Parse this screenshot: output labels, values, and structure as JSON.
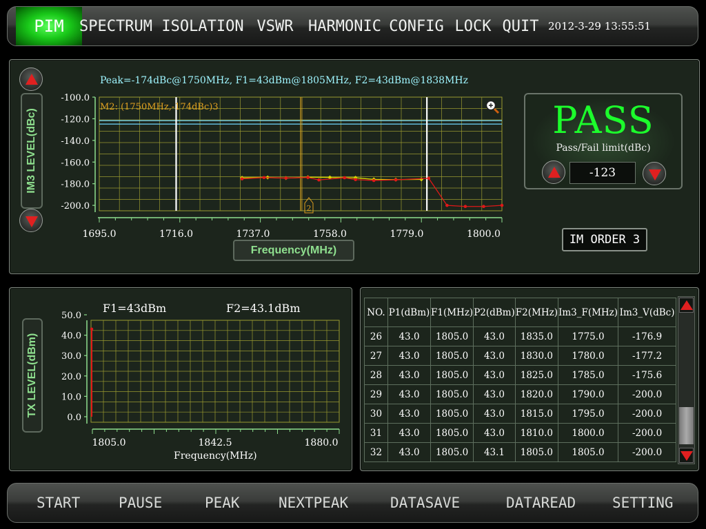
{
  "header": {
    "menu": [
      "PIM",
      "SPECTRUM",
      "ISOLATION",
      "VSWR",
      "HARMONIC",
      "CONFIG",
      "LOCK",
      "QUIT"
    ],
    "datetime": "2012-3-29 13:55:51"
  },
  "im3_panel": {
    "peak_info": "Peak=-174dBc@1750MHz, F1=43dBm@1805MHz, F2=43dBm@1838MHz",
    "y_axis_label": "IM3 LEVEL(dBc)",
    "x_axis_button": "Frequency(MHz)",
    "marker_label": "M2: (1750MHz,-174dBc)3",
    "marker_tag": "2",
    "zoom_icon": "magnifier-plus-icon"
  },
  "pass_panel": {
    "result": "PASS",
    "limit_label": "Pass/Fail limit(dBc)",
    "limit_value": "-123",
    "im_order": "IM ORDER 3"
  },
  "tx_panel": {
    "f1": "F1=43dBm",
    "f2": "F2=43.1dBm",
    "y_axis_label": "TX LEVEL(dBm)",
    "x_axis_label": "Frequency(MHz)"
  },
  "table": {
    "headers": [
      "NO.",
      "P1(dBm)",
      "F1(MHz)",
      "P2(dBm)",
      "F2(MHz)",
      "Im3_F(MHz)",
      "Im3_V(dBc)"
    ],
    "rows": [
      [
        "26",
        "43.0",
        "1805.0",
        "43.0",
        "1835.0",
        "1775.0",
        "-176.9"
      ],
      [
        "27",
        "43.0",
        "1805.0",
        "43.0",
        "1830.0",
        "1780.0",
        "-177.2"
      ],
      [
        "28",
        "43.0",
        "1805.0",
        "43.0",
        "1825.0",
        "1785.0",
        "-175.6"
      ],
      [
        "29",
        "43.0",
        "1805.0",
        "43.0",
        "1820.0",
        "1790.0",
        "-200.0"
      ],
      [
        "30",
        "43.0",
        "1805.0",
        "43.0",
        "1815.0",
        "1795.0",
        "-200.0"
      ],
      [
        "31",
        "43.0",
        "1805.0",
        "43.0",
        "1810.0",
        "1800.0",
        "-200.0"
      ],
      [
        "32",
        "43.0",
        "1805.0",
        "43.1",
        "1805.0",
        "1805.0",
        "-200.0"
      ]
    ]
  },
  "footer": {
    "buttons": [
      "START",
      "PAUSE",
      "PEAK",
      "NEXTPEAK",
      "DATASAVE",
      "DATAREAD",
      "SETTING"
    ]
  },
  "colors": {
    "pass": "#1cff2c",
    "limit_line": "#6fd6ff",
    "series_red": "#e01818",
    "series_yellow": "#d8d800",
    "grid": "#9a9a30"
  },
  "chart_data": [
    {
      "type": "line",
      "ylabel": "IM3 LEVEL(dBc)",
      "xlabel": "Frequency(MHz)",
      "x_ticks": [
        1695.0,
        1716.0,
        1737.0,
        1758.0,
        1779.0,
        1800.0
      ],
      "y_ticks": [
        -100.0,
        -120.0,
        -140.0,
        -160.0,
        -180.0,
        -200.0
      ],
      "xlim": [
        1695,
        1805
      ],
      "ylim": [
        -205,
        -100
      ],
      "limit_line": -123,
      "marker_lines": [
        1716,
        1750,
        1784.5
      ],
      "series": [
        {
          "x": [
            1734,
            1741,
            1746,
            1752,
            1758,
            1765,
            1770,
            1776,
            1783
          ],
          "y": [
            -174.5,
            -174.2,
            -174.8,
            -174.0,
            -174.2,
            -174.5,
            -176.0,
            -176.2,
            -176.0
          ]
        },
        {
          "x": [
            1734,
            1740,
            1746,
            1752,
            1755,
            1762,
            1765,
            1770,
            1776,
            1785,
            1790,
            1795,
            1800,
            1805
          ],
          "y": [
            -175.5,
            -174.3,
            -174.8,
            -174.2,
            -176.5,
            -174.5,
            -176.2,
            -177.0,
            -176.4,
            -175.0,
            -200,
            -201,
            -201,
            -200
          ]
        }
      ]
    },
    {
      "type": "line",
      "ylabel": "TX LEVEL(dBm)",
      "xlabel": "Frequency(MHz)",
      "x_ticks": [
        1805.0,
        1842.5,
        1880.0
      ],
      "y_ticks": [
        50.0,
        40.0,
        30.0,
        20.0,
        10.0,
        0.0
      ],
      "xlim": [
        1805,
        1880
      ],
      "ylim": [
        0,
        50
      ],
      "series": [
        {
          "x": [
            1805,
            1805
          ],
          "y": [
            0,
            43
          ]
        }
      ]
    }
  ]
}
